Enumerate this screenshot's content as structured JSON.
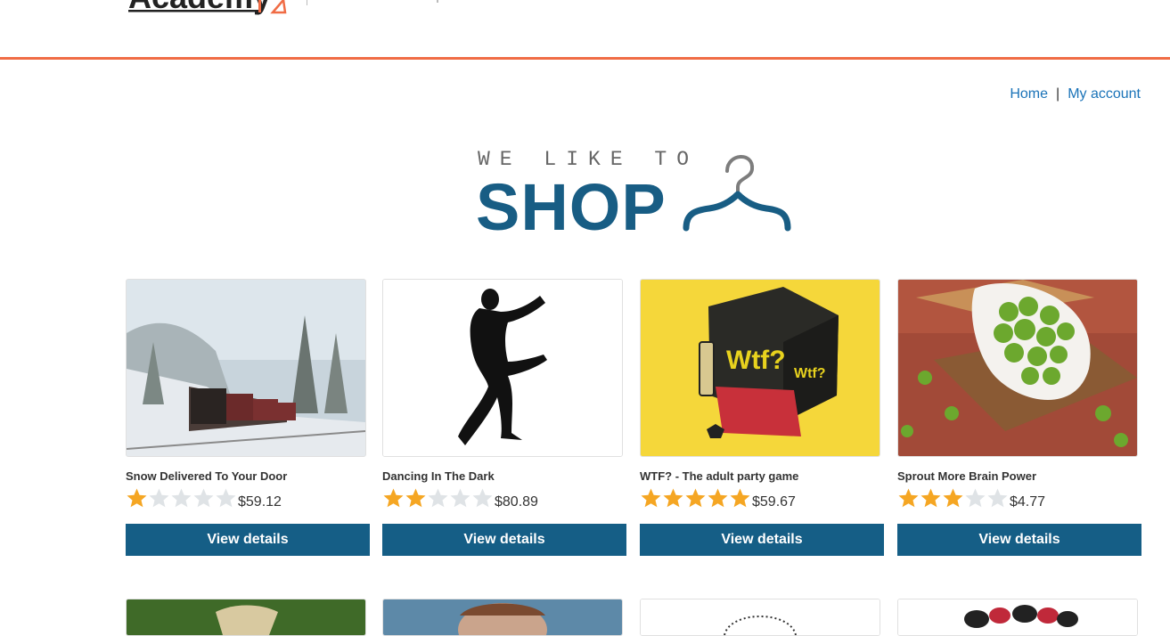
{
  "header": {
    "logo_text": "Academy",
    "accent_color": "#f06c45"
  },
  "nav": {
    "home": "Home",
    "separator": "|",
    "account": "My account"
  },
  "banner": {
    "tagline": "WE LIKE TO",
    "title": "SHOP",
    "icon": "hanger-icon"
  },
  "products": [
    {
      "name": "Snow Delivered To Your Door",
      "rating": 1,
      "price": "$59.12",
      "button": "View details",
      "image": "snowy-train-image"
    },
    {
      "name": "Dancing In The Dark",
      "rating": 2,
      "price": "$80.89",
      "button": "View details",
      "image": "dancing-silhouette-image"
    },
    {
      "name": "WTF? - The adult party game",
      "rating": 5,
      "price": "$59.67",
      "button": "View details",
      "image": "party-game-box-image"
    },
    {
      "name": "Sprout More Brain Power",
      "rating": 3,
      "price": "$4.77",
      "button": "View details",
      "image": "brussels-sprouts-image"
    }
  ],
  "colors": {
    "button_bg": "#155e86",
    "star_filled": "#f5a623",
    "star_empty": "#dfe3e6",
    "link": "#1a73b8"
  }
}
